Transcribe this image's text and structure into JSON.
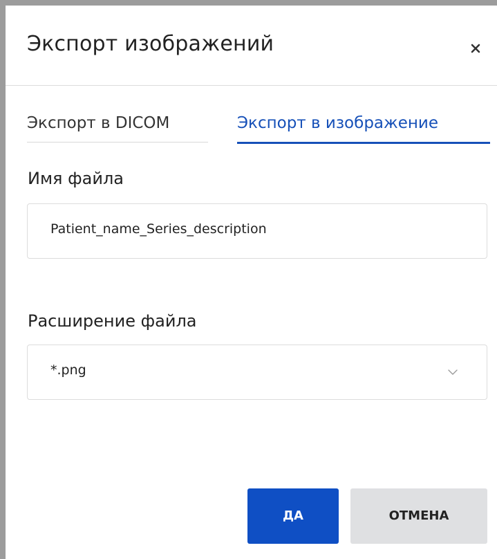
{
  "dialog": {
    "title": "Экспорт изображений",
    "close_icon": "close-icon"
  },
  "tabs": [
    {
      "label": "Экспорт в DICOM",
      "active": false
    },
    {
      "label": "Экспорт в изображение",
      "active": true
    }
  ],
  "form": {
    "filename_label": "Имя файла",
    "filename_value": "Patient_name_Series_description",
    "extension_label": "Расширение файла",
    "extension_value": "*.png",
    "extension_icon": "chevron-down-icon"
  },
  "buttons": {
    "ok_label": "ДА",
    "cancel_label": "ОТМЕНА"
  },
  "colors": {
    "accent": "#1650b8",
    "primary_button": "#0f4fc4",
    "secondary_button": "#dfe0e2",
    "backdrop": "#9c9c9c"
  }
}
